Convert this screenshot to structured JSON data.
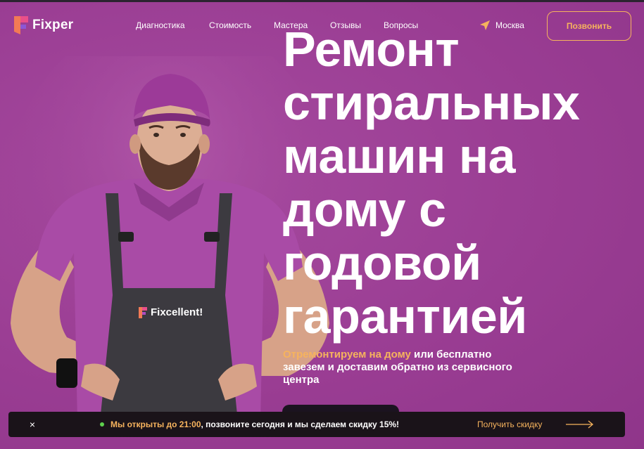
{
  "header": {
    "logo_text": "Fixper",
    "nav": [
      "Диагностика",
      "Стоимость",
      "Мастера",
      "Отзывы",
      "Вопросы"
    ],
    "city": "Москва",
    "call_button": "Позвонить"
  },
  "hero": {
    "headline_lines": [
      "Ремонт",
      "стиральных",
      "машин на",
      "дому с",
      "годовой",
      "гарантией"
    ],
    "sub_accent": "Отремонтируем на дому",
    "sub_rest": " или бесплатно завезем и доставим обратно из сервисного центра",
    "apron_logo": "Fixcellent!"
  },
  "promo": {
    "close": "×",
    "text_accent": "Мы открыты до 21:00",
    "text_rest": ", позвоните сегодня и мы сделаем скидку 15%!",
    "link": "Получить скидку"
  },
  "colors": {
    "background": "#9c3f96",
    "accent": "#f6b35d",
    "dark": "#1a1319",
    "status_green": "#5ed04d"
  }
}
